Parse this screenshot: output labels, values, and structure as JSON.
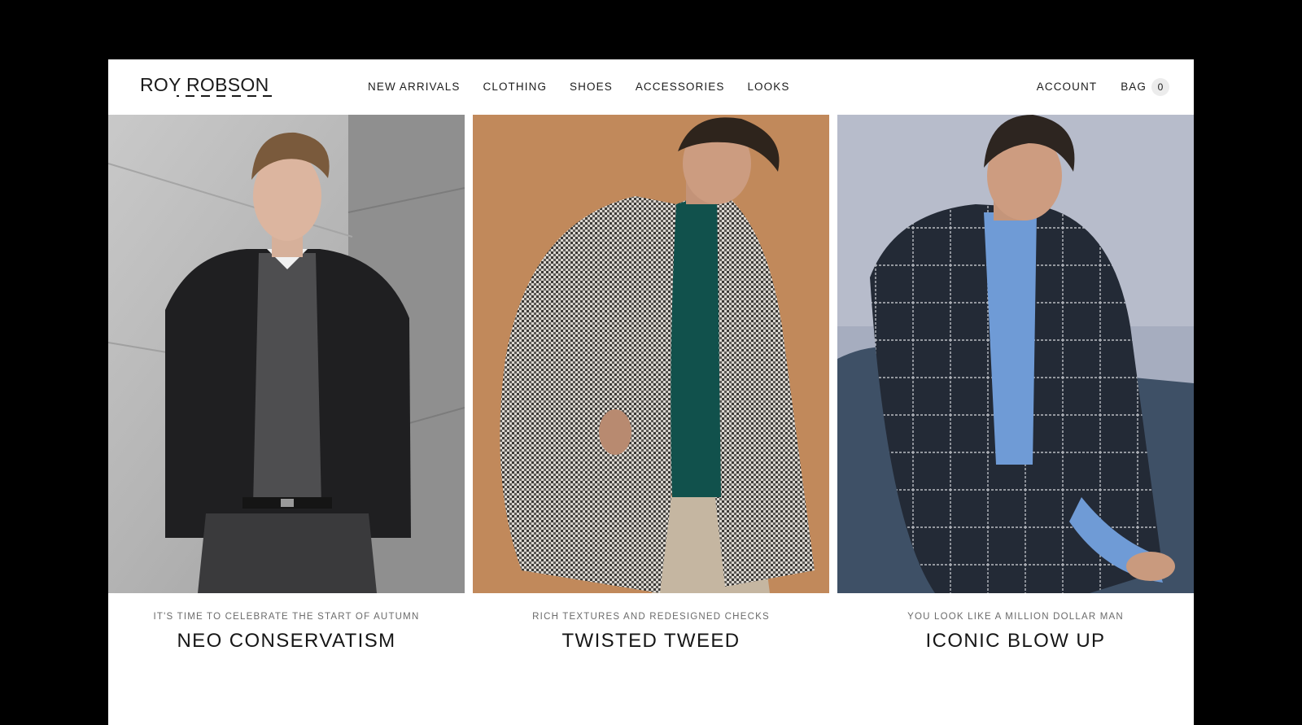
{
  "brand": {
    "name": "ROY ROBSON"
  },
  "nav": {
    "items": [
      {
        "label": "NEW ARRIVALS"
      },
      {
        "label": "CLOTHING"
      },
      {
        "label": "SHOES"
      },
      {
        "label": "ACCESSORIES"
      },
      {
        "label": "LOOKS"
      }
    ]
  },
  "utility": {
    "account_label": "ACCOUNT",
    "bag_label": "BAG",
    "bag_count": "0"
  },
  "panels": [
    {
      "kicker": "IT'S TIME TO CELEBRATE THE START OF AUTUMN",
      "title": "NEO CONSERVATISM",
      "image": "man-in-black-bomber-jacket-against-marble-wall"
    },
    {
      "kicker": "RICH TEXTURES AND REDESIGNED CHECKS",
      "title": "TWISTED TWEED",
      "image": "man-in-houndstooth-coat-on-tan-background"
    },
    {
      "kicker": "YOU LOOK LIKE A MILLION DOLLAR MAN",
      "title": "ICONIC BLOW UP",
      "image": "smiling-man-in-windowpane-check-suit-seated"
    }
  ],
  "colors": {
    "page_background": "#000000",
    "site_background": "#ffffff",
    "text": "#1c1c1c",
    "kicker_text": "#6b6b6b",
    "bag_badge": "#ececec"
  }
}
